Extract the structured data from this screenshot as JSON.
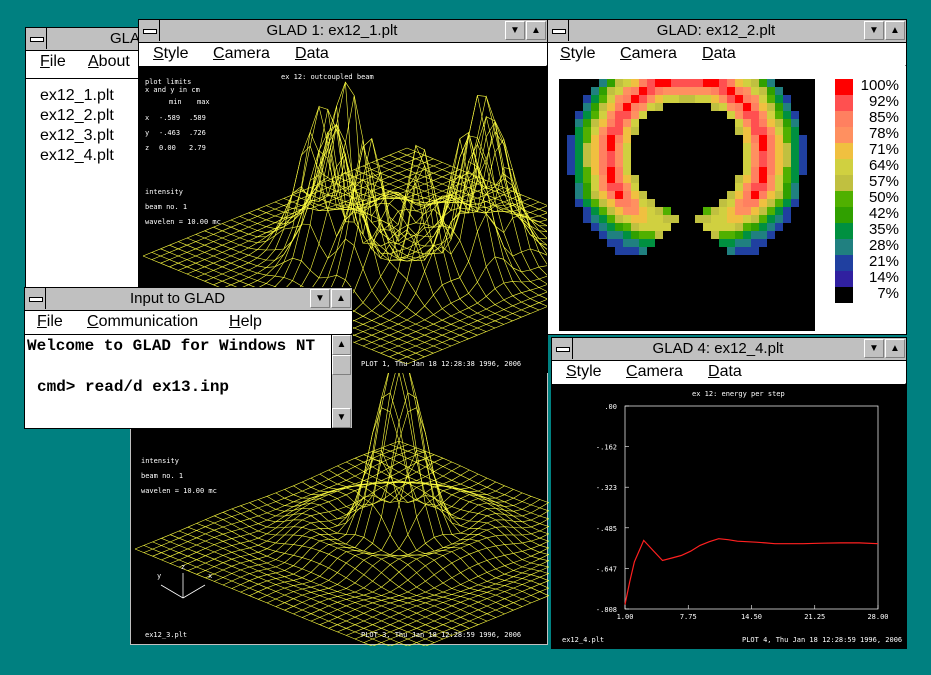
{
  "windows": {
    "main": {
      "title": "GLAD",
      "menu": [
        "File",
        "About"
      ],
      "files": [
        "ex12_1.plt",
        "ex12_2.plt",
        "ex12_3.plt",
        "ex12_4.plt"
      ]
    },
    "plot1": {
      "title": "GLAD 1: ex12_1.plt",
      "menu": [
        "Style",
        "Camera",
        "Data"
      ],
      "heading": "ex 12: outcoupled beam",
      "limits_title": "plot limits",
      "limits_sub": "x and y in cm",
      "min_label": "min",
      "max_label": "max",
      "rows": [
        {
          "axis": "x",
          "min": "-.589",
          "max": ".589"
        },
        {
          "axis": "y",
          "min": "-.463",
          "max": ".726"
        },
        {
          "axis": "z",
          "min": "0.00",
          "max": "2.79"
        }
      ],
      "quantity": "intensity",
      "beam": "beam no. 1",
      "wavelen": "wavelen = 10.00  mc",
      "footer": "PLOT 1, Thu Jan 18 12:28:38 1996, 2006"
    },
    "plot3": {
      "quantity": "intensity",
      "beam": "beam no. 1",
      "wavelen": "wavelen = 10.00  mc",
      "file_label": "ex12_3.plt",
      "footer": "PLOT 3, Thu Jan 18 12:28:59 1996, 2006",
      "axis_y": "y",
      "axis_z": "z",
      "axis_x": "x"
    },
    "plot2": {
      "title": "GLAD: ex12_2.plt",
      "menu": [
        "Style",
        "Camera",
        "Data"
      ],
      "legend": [
        "100%",
        "92%",
        "85%",
        "78%",
        "71%",
        "64%",
        "57%",
        "50%",
        "42%",
        "35%",
        "28%",
        "21%",
        "14%",
        "7%"
      ],
      "legend_colors": [
        "#ff0000",
        "#ff5050",
        "#ff8060",
        "#ff9060",
        "#f0c040",
        "#d0d040",
        "#c0c040",
        "#50b000",
        "#30a000",
        "#009040",
        "#208080",
        "#2040a0",
        "#3020a0",
        "#000000"
      ]
    },
    "input": {
      "title": "Input to GLAD",
      "menu": [
        "File",
        "Communication",
        "Help"
      ],
      "line1": "Welcome to GLAD for Windows NT",
      "line2": "cmd> read/d ex13.inp"
    },
    "plot4": {
      "title": "GLAD 4: ex12_4.plt",
      "menu": [
        "Style",
        "Camera",
        "Data"
      ],
      "file_label": "ex12_4.plt",
      "footer": "PLOT 4, Thu Jan 18 12:28:59 1996, 2006"
    }
  },
  "chart_data": {
    "type": "line",
    "title": "ex 12: energy per step",
    "x_ticks": [
      "1.00",
      "7.75",
      "14.50",
      "21.25",
      "28.00"
    ],
    "y_ticks": [
      ".00",
      "-.162",
      "-.323",
      "-.485",
      "-.647",
      "-.808"
    ],
    "xlim": [
      1,
      28
    ],
    "ylim": [
      -0.808,
      0
    ],
    "line_color": "#ff2020",
    "x": [
      1,
      1.5,
      2,
      3,
      4,
      5,
      6,
      7,
      8,
      9,
      10,
      11,
      12,
      13,
      14,
      15,
      16,
      17,
      18,
      20,
      22,
      24,
      26,
      28
    ],
    "y": [
      -0.79,
      -0.7,
      -0.62,
      -0.535,
      -0.575,
      -0.615,
      -0.605,
      -0.595,
      -0.578,
      -0.555,
      -0.54,
      -0.528,
      -0.532,
      -0.538,
      -0.54,
      -0.542,
      -0.545,
      -0.548,
      -0.548,
      -0.548,
      -0.546,
      -0.545,
      -0.545,
      -0.548
    ]
  }
}
